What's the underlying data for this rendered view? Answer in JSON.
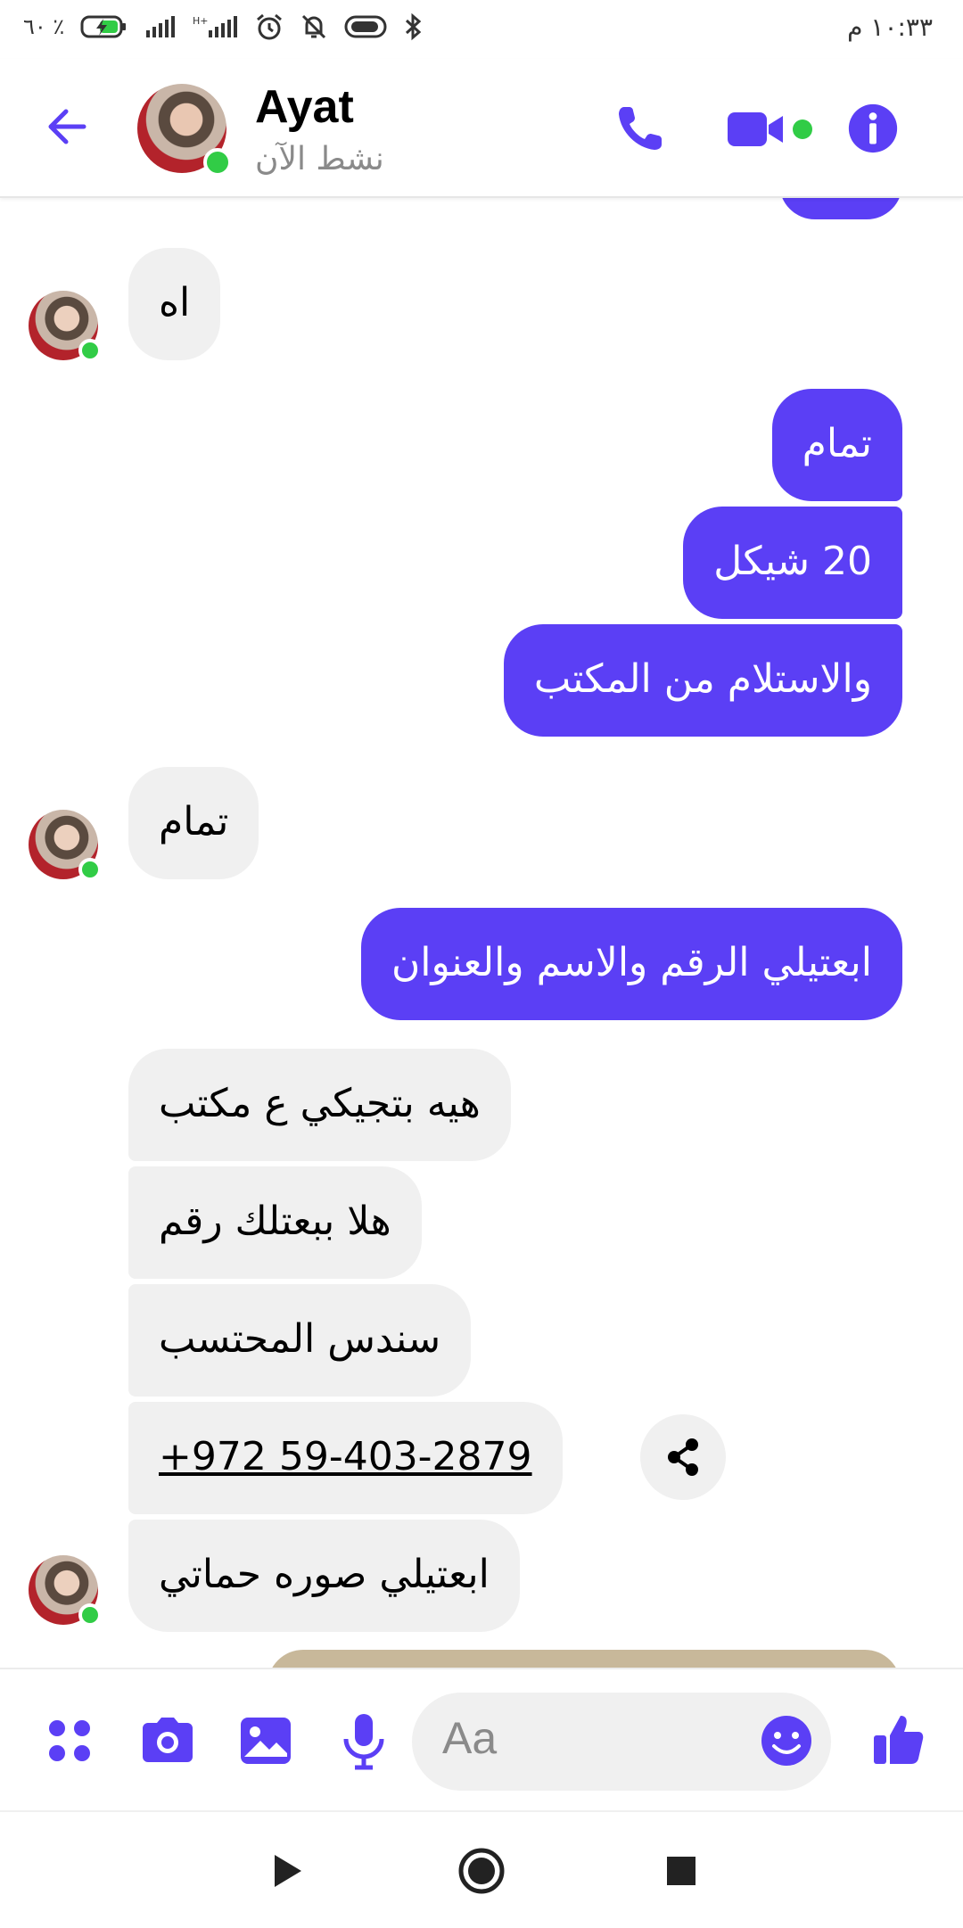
{
  "status_bar": {
    "battery": "٦٠ ٪",
    "time": "١٠:٣٣ م",
    "icons": [
      "battery-charging-icon",
      "signal-icon",
      "signal-hplus-icon",
      "alarm-icon",
      "bell-off-icon",
      "toggle-icon",
      "bluetooth-icon"
    ]
  },
  "header": {
    "name": "Ayat",
    "status": "نشط الآن",
    "icons": [
      "back-arrow-icon",
      "phone-icon",
      "video-icon",
      "info-icon"
    ]
  },
  "messages": [
    {
      "id": "m1",
      "side": "in",
      "text": "اه"
    },
    {
      "id": "m2",
      "side": "out",
      "text": "تمام"
    },
    {
      "id": "m3",
      "side": "out",
      "text": "20 شيكل"
    },
    {
      "id": "m4",
      "side": "out",
      "text": "والاستلام من المكتب"
    },
    {
      "id": "m5",
      "side": "in",
      "text": "تمام"
    },
    {
      "id": "m6",
      "side": "out",
      "text": "ابعتيلي الرقم والاسم والعنوان"
    },
    {
      "id": "m7",
      "side": "in",
      "text": "هيه بتجيكي ع مكتب"
    },
    {
      "id": "m8",
      "side": "in",
      "text": "هلا ببعتلك رقم"
    },
    {
      "id": "m9",
      "side": "in",
      "text": "سندس المحتسب"
    },
    {
      "id": "m10",
      "side": "in",
      "text": "+972 59-403-2879"
    },
    {
      "id": "m11",
      "side": "in",
      "text": "ابعتيلي صوره حماتي"
    }
  ],
  "composer": {
    "placeholder": "Aa",
    "icons": [
      "apps-icon",
      "camera-icon",
      "gallery-icon",
      "microphone-icon",
      "emoji-icon",
      "thumbs-up-icon"
    ]
  },
  "navbar": {
    "icons": [
      "back-triangle-icon",
      "home-circle-icon",
      "recents-square-icon"
    ]
  },
  "colors": {
    "accent": "#5b3ff5",
    "incoming": "#f0f0f0",
    "online": "#31cc46"
  }
}
